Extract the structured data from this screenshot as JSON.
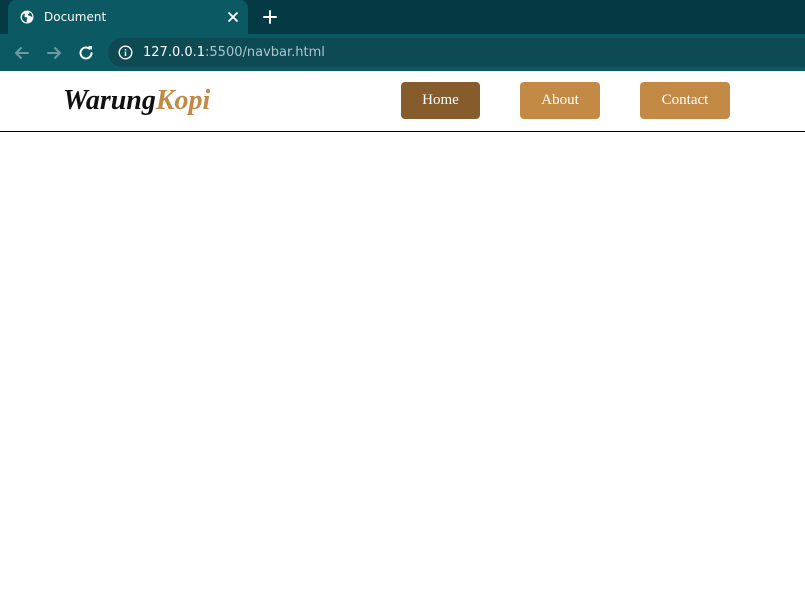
{
  "browser": {
    "tab": {
      "title": "Document",
      "favicon": "globe-icon",
      "close_icon": "close-icon"
    },
    "new_tab_icon": "plus-icon",
    "toolbar": {
      "back_icon": "arrow-left-icon",
      "forward_icon": "arrow-right-icon",
      "reload_icon": "reload-icon",
      "info_icon": "info-icon",
      "url_host": "127.0.0.1",
      "url_path": ":5500/navbar.html"
    },
    "colors": {
      "tab_strip": "#043a44",
      "toolbar": "#0b5963",
      "omnibox": "#0e4a54"
    }
  },
  "page": {
    "logo": {
      "part1": "Warung",
      "part2": "Kopi"
    },
    "nav_items": [
      {
        "label": "Home",
        "active": true
      },
      {
        "label": "About",
        "active": false
      },
      {
        "label": "Contact",
        "active": false
      }
    ],
    "colors": {
      "accent": "#c28a45",
      "active": "#865c2c",
      "logo_dark": "#111111"
    }
  }
}
